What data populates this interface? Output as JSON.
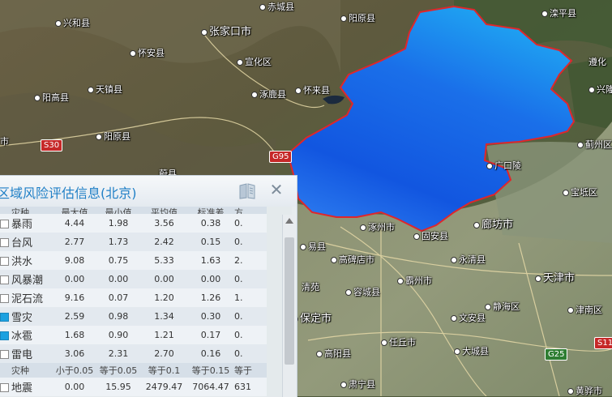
{
  "map": {
    "place_labels": [
      {
        "id": "xinghexian",
        "text": "兴和县"
      },
      {
        "id": "chicheng",
        "text": "赤城县"
      },
      {
        "id": "luanping",
        "text": "滦平县"
      },
      {
        "id": "zhangjiakou",
        "text": "张家口市"
      },
      {
        "id": "huaian",
        "text": "怀安县"
      },
      {
        "id": "xuanhua",
        "text": "宣化区"
      },
      {
        "id": "longhua",
        "text": "隆子"
      },
      {
        "id": "tianzhen",
        "text": "天镇县"
      },
      {
        "id": "huailai",
        "text": "怀来县"
      },
      {
        "id": "yanggao",
        "text": "阳高县"
      },
      {
        "id": "zhuolu",
        "text": "涿鹿县"
      },
      {
        "id": "yangyuan",
        "text": "阳原县"
      },
      {
        "id": "shi_left",
        "text": "市"
      },
      {
        "id": "weixian",
        "text": "蔚县"
      },
      {
        "id": "langfang",
        "text": "廊坊市"
      },
      {
        "id": "zhuozhou",
        "text": "涿州市"
      },
      {
        "id": "guan",
        "text": "固安县"
      },
      {
        "id": "gaobeidian",
        "text": "高碑店市"
      },
      {
        "id": "yongqing",
        "text": "永清县"
      },
      {
        "id": "bazhou",
        "text": "霸州市"
      },
      {
        "id": "rongcheng",
        "text": "容城县"
      },
      {
        "id": "baoding",
        "text": "保定市"
      },
      {
        "id": "anxin",
        "text": "安新县"
      },
      {
        "id": "wenan",
        "text": "文安县"
      },
      {
        "id": "tianjin",
        "text": "天津市"
      },
      {
        "id": "jinghai",
        "text": "静海区"
      },
      {
        "id": "jinnan",
        "text": "津南区"
      },
      {
        "id": "renqiu",
        "text": "任丘市"
      },
      {
        "id": "gaoyang",
        "text": "高阳县"
      },
      {
        "id": "daicheng",
        "text": "大城县"
      },
      {
        "id": "suning",
        "text": "肃宁县"
      },
      {
        "id": "huanghua",
        "text": "黄骅市"
      },
      {
        "id": "jizhou",
        "text": "蓟州区"
      },
      {
        "id": "baodi",
        "text": "宝坻区"
      },
      {
        "id": "xinglong",
        "text": "兴隆"
      },
      {
        "id": "zunhua",
        "text": "遵化"
      },
      {
        "id": "sanhe",
        "text": "广口陵"
      },
      {
        "id": "yixian",
        "text": "易县"
      },
      {
        "id": "laishui",
        "text": "涞水县"
      },
      {
        "id": "dingxing",
        "text": "定兴"
      },
      {
        "id": "xushui",
        "text": "徐水区"
      },
      {
        "id": "qingyuan",
        "text": "清苑"
      }
    ],
    "road_shields": [
      {
        "id": "s30",
        "text": "S30"
      },
      {
        "id": "g95",
        "text": "G95"
      },
      {
        "id": "g25",
        "text": "G25"
      },
      {
        "id": "s11",
        "text": "S11"
      }
    ],
    "region_fill_color": "#1e6fe6",
    "region_border_color": "#e0262b"
  },
  "panel": {
    "title": "区域风险评估信息(北京)",
    "header1": {
      "type": "灾种",
      "c1": "最大值",
      "c2": "最小值",
      "c3": "平均值",
      "c4": "标准差",
      "c5": "方"
    },
    "rows": [
      {
        "checked": false,
        "name": "暴雨",
        "c1": "4.44",
        "c2": "1.98",
        "c3": "3.56",
        "c4": "0.38",
        "c5": "0."
      },
      {
        "checked": false,
        "name": "台风",
        "c1": "2.77",
        "c2": "1.73",
        "c3": "2.42",
        "c4": "0.15",
        "c5": "0."
      },
      {
        "checked": false,
        "name": "洪水",
        "c1": "9.08",
        "c2": "0.75",
        "c3": "5.33",
        "c4": "1.63",
        "c5": "2."
      },
      {
        "checked": false,
        "name": "风暴潮",
        "c1": "0.00",
        "c2": "0.00",
        "c3": "0.00",
        "c4": "0.00",
        "c5": "0."
      },
      {
        "checked": false,
        "name": "泥石流",
        "c1": "9.16",
        "c2": "0.07",
        "c3": "1.20",
        "c4": "1.26",
        "c5": "1."
      },
      {
        "checked": true,
        "name": "雪灾",
        "c1": "2.59",
        "c2": "0.98",
        "c3": "1.34",
        "c4": "0.30",
        "c5": "0."
      },
      {
        "checked": true,
        "name": "冰雹",
        "c1": "1.68",
        "c2": "0.90",
        "c3": "1.21",
        "c4": "0.17",
        "c5": "0."
      },
      {
        "checked": false,
        "name": "雷电",
        "c1": "3.06",
        "c2": "2.31",
        "c3": "2.70",
        "c4": "0.16",
        "c5": "0."
      }
    ],
    "header2": {
      "type": "灾种",
      "c1": "小于0.05",
      "c2": "等于0.05",
      "c3": "等于0.1",
      "c4": "等于0.15",
      "c5": "等于"
    },
    "rows2": [
      {
        "checked": false,
        "name": "地震",
        "c1": "0.00",
        "c2": "15.95",
        "c3": "2479.47",
        "c4": "7064.47",
        "c5": "631"
      }
    ]
  }
}
